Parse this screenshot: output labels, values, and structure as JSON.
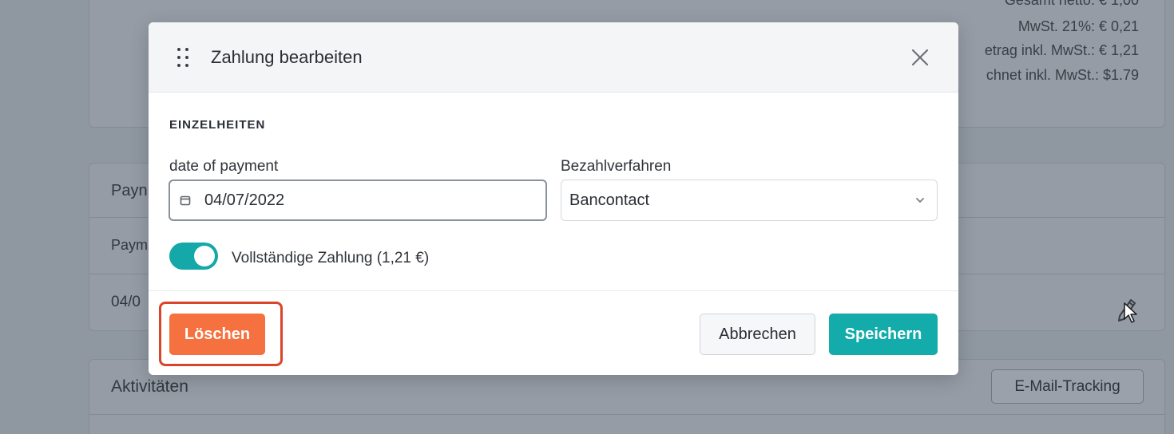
{
  "background": {
    "totals": {
      "line1": "Gesamt netto: € 1,00",
      "line2": "MwSt. 21%: € 0,21",
      "line3": "etrag inkl. MwSt.: € 1,21",
      "line4": "chnet inkl. MwSt.: $1.79"
    },
    "payments_card": {
      "title": "Payn",
      "column_header": "Paym",
      "row_date": "04/0"
    },
    "activities_card": {
      "title": "Aktivitäten",
      "email_tracking_button": "E-Mail-Tracking"
    }
  },
  "modal": {
    "title": "Zahlung bearbeiten",
    "section_title": "EINZELHEITEN",
    "date_label": "date of payment",
    "date_value": "04/07/2022",
    "method_label": "Bezahlverfahren",
    "method_value": "Bancontact",
    "full_payment_label": "Vollständige Zahlung (1,21 €)",
    "full_payment_on": true,
    "buttons": {
      "delete": "Löschen",
      "cancel": "Abbrechen",
      "save": "Speichern"
    }
  },
  "colors": {
    "accent": "#14abab",
    "danger": "#f5713f",
    "highlight": "#d9452b",
    "overlay": "#8f97a1"
  }
}
